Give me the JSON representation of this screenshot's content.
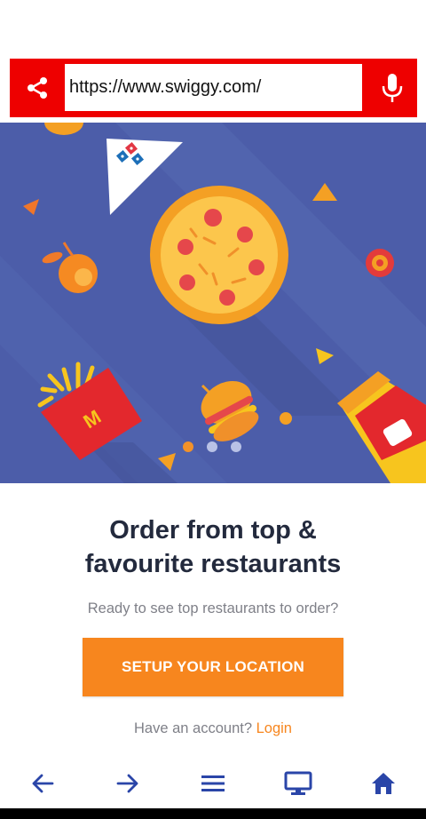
{
  "browser": {
    "url": "https://www.swiggy.com/",
    "icons": {
      "share": "share-icon",
      "mic": "microphone-icon"
    },
    "accent_color": "#ee0000"
  },
  "carousel": {
    "slide_count": 3,
    "active_index": 0,
    "background_color": "#4c5da9"
  },
  "content": {
    "headline_line1": "Order from top &",
    "headline_line2": "favourite restaurants",
    "subtitle": "Ready to see top restaurants to order?",
    "cta_label": "SETUP YOUR LOCATION",
    "account_prompt": "Have an account?",
    "login_label": "Login",
    "brand_color": "#f7861e"
  },
  "bottom_nav": {
    "items": [
      "back-arrow-icon",
      "forward-arrow-icon",
      "menu-icon",
      "desktop-icon",
      "home-icon"
    ],
    "icon_color": "#2a45a8"
  }
}
